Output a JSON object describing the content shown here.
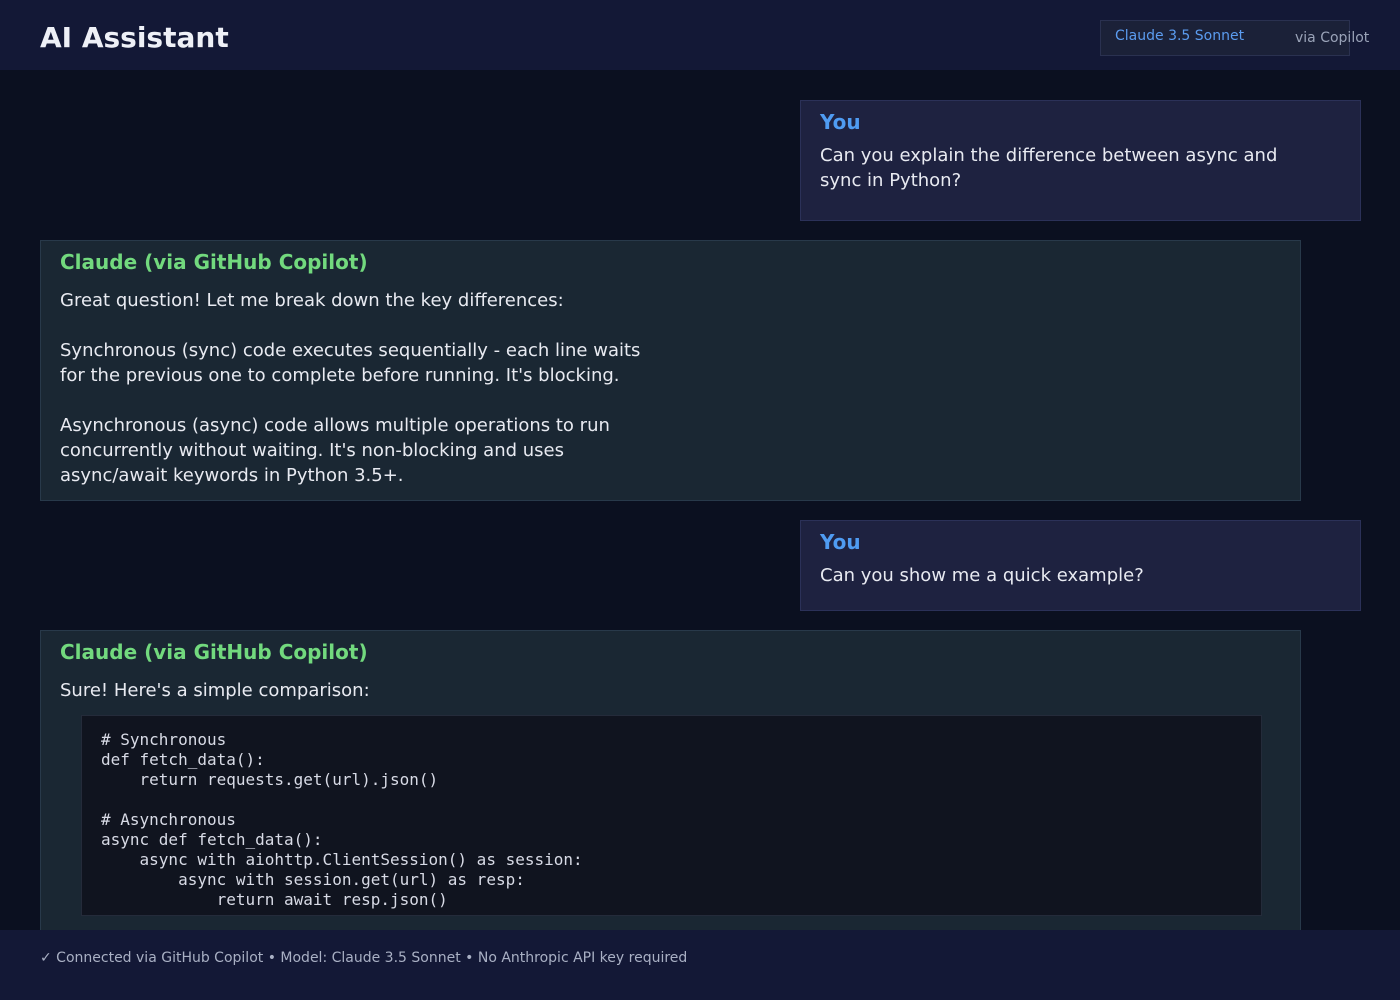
{
  "header": {
    "title": "AI Assistant",
    "model_name": "Claude 3.5 Sonnet",
    "model_via": "via Copilot"
  },
  "messages": [
    {
      "role": "user",
      "sender": "You",
      "text": "Can you explain the difference between async and sync in Python?"
    },
    {
      "role": "assistant",
      "sender": "Claude (via GitHub Copilot)",
      "text": "Great question! Let me break down the key differences:\n\nSynchronous (sync) code executes sequentially - each line waits for the previous one to complete before running. It's blocking.\n\nAsynchronous (async) code allows multiple operations to run concurrently without waiting. It's non-blocking and uses async/await keywords in Python 3.5+."
    },
    {
      "role": "user",
      "sender": "You",
      "text": "Can you show me a quick example?"
    },
    {
      "role": "assistant",
      "sender": "Claude (via GitHub Copilot)",
      "text": "Sure! Here's a simple comparison:",
      "code": "# Synchronous\ndef fetch_data():\n    return requests.get(url).json()\n\n# Asynchronous\nasync def fetch_data():\n    async with aiohttp.ClientSession() as session:\n        async with session.get(url) as resp:\n            return await resp.json()"
    }
  ],
  "footer": {
    "status": "✓ Connected via GitHub Copilot • Model: Claude 3.5 Sonnet • No Anthropic API key required"
  },
  "colors": {
    "user_sender": "#4f9cf2",
    "assistant_sender": "#72d97e",
    "model_badge": "#5b9cf0",
    "background": "#0b1020",
    "header_footer": "#131836"
  }
}
